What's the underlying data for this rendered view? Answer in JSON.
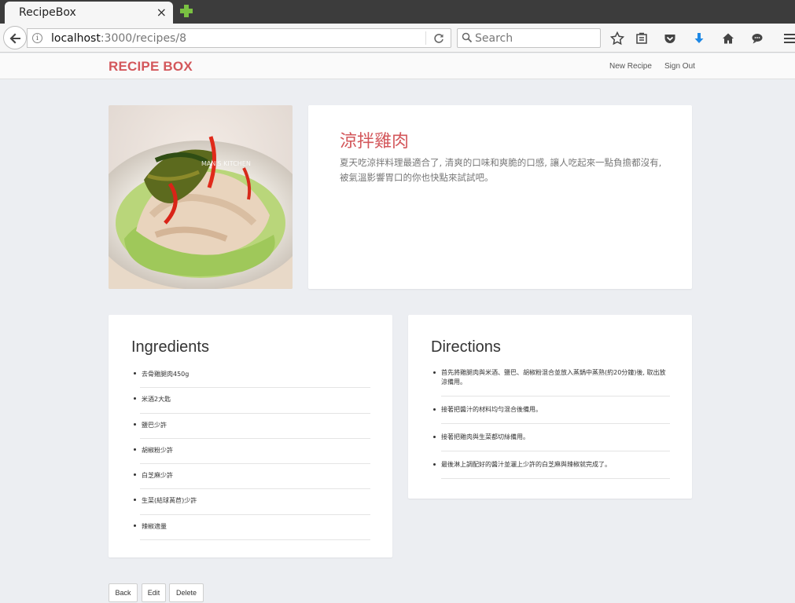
{
  "browser": {
    "tab_title": "RecipeBox",
    "tab_close": "×",
    "url_host": "localhost",
    "url_path": ":3000/recipes/8",
    "search_placeholder": "Search"
  },
  "header": {
    "brand": "RECIPE BOX",
    "nav": [
      "New Recipe",
      "Sign Out"
    ]
  },
  "recipe": {
    "title": "涼拌雞肉",
    "description": "夏天吃涼拌料理最適合了, 清爽的口味和爽脆的口感, 讓人吃起來一點負擔都沒有, 被氣溫影響胃口的你也快點來試試吧。",
    "image_watermark": "MAN'S KITCHEN"
  },
  "ingredients": {
    "title": "Ingredients",
    "items": [
      "去骨雞腿肉450g",
      "米酒2大匙",
      "鹽巴少許",
      "胡椒粉少許",
      "白芝麻少許",
      "生菜(結球萵苣)少許",
      "辣椒適量"
    ]
  },
  "directions": {
    "title": "Directions",
    "items": [
      "首先將雞腿肉與米酒、鹽巴、胡椒粉混合並放入蒸鍋中蒸熟(約20分鐘)後, 取出放涼備用。",
      "接著把醬汁的材料均勻混合後備用。",
      "接著把雞肉與生菜都切絲備用。",
      "最後淋上調配好的醬汁並灑上少許的白芝麻與辣椒就完成了。"
    ]
  },
  "actions": {
    "back": "Back",
    "edit": "Edit",
    "delete": "Delete"
  },
  "colors": {
    "accent": "#d3575b",
    "background": "#eceef2"
  }
}
